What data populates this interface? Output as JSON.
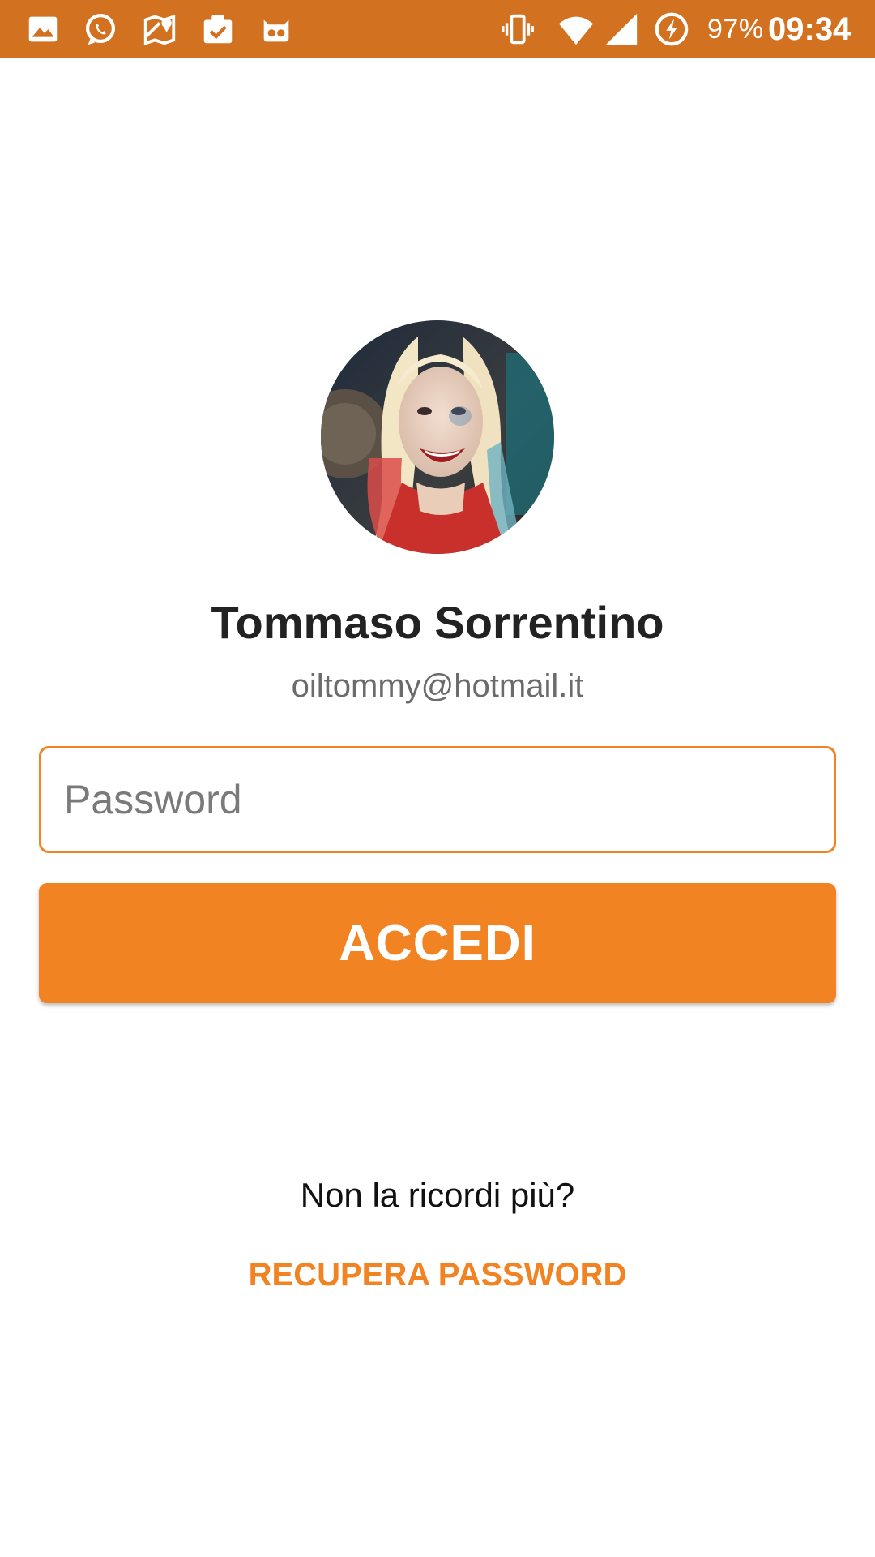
{
  "status_bar": {
    "icons": [
      "image-icon",
      "whatsapp-icon",
      "maps-icon",
      "clipboard-check-icon",
      "cyanogen-icon",
      "vibrate-icon",
      "wifi-icon",
      "signal-icon",
      "battery-charging-icon"
    ],
    "battery_percent": "97%",
    "time": "09:34"
  },
  "profile": {
    "name": "Tommaso Sorrentino",
    "email": "oiltommy@hotmail.it"
  },
  "login": {
    "password_placeholder": "Password",
    "submit_label": "ACCEDI"
  },
  "recovery": {
    "prompt": "Non la ricordi più?",
    "link_label": "RECUPERA PASSWORD"
  },
  "colors": {
    "status_bar": "#D2711F",
    "accent": "#F28322",
    "name_text": "#222222",
    "email_text": "#6B6B6B"
  }
}
